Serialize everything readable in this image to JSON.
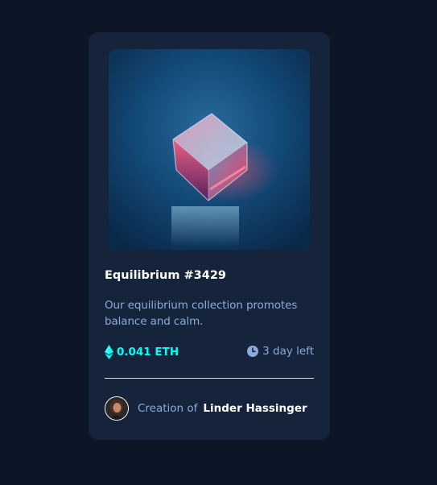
{
  "nft": {
    "title": "Equilibrium #3429",
    "description": "Our equilibrium collection promotes balance and calm.",
    "price": "0.041 ETH",
    "time_left": "3 day left",
    "creator_prefix": "Creation of",
    "creator_name": "Linder Hassinger"
  },
  "icons": {
    "price_icon": "ethereum-icon",
    "time_icon": "clock-icon"
  },
  "colors": {
    "background": "#0d1627",
    "card": "#15233b",
    "accent_cyan": "#00fff8",
    "soft_blue": "#8bacd9",
    "white": "#ffffff"
  }
}
